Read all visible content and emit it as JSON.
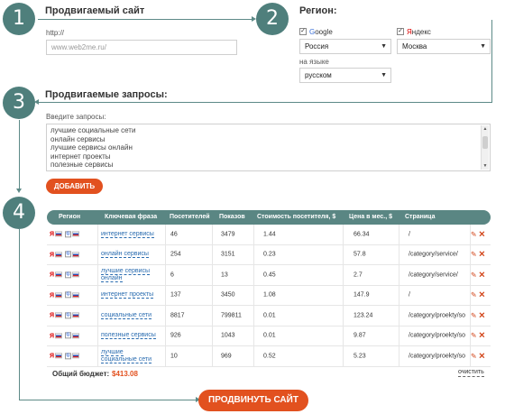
{
  "steps": [
    "1",
    "2",
    "3",
    "4"
  ],
  "site": {
    "title": "Продвигаемый сайт",
    "protocol": "http://",
    "placeholder": "www.web2me.ru/"
  },
  "region": {
    "title": "Регион:",
    "google": {
      "label_g": "G",
      "label_rest": "oogle",
      "checked": true,
      "value": "Россия"
    },
    "yandex": {
      "label_y": "Я",
      "label_rest": "ндекс",
      "checked": true,
      "value": "Москва"
    },
    "lang_label": "на языке",
    "lang_value": "русском"
  },
  "queries": {
    "title": "Продвигаемые запросы:",
    "label": "Введите запросы:",
    "lines": [
      "лучшие социальные сети",
      "онлайн сервисы",
      "лучшие сервисы онлайн",
      "интернет проекты",
      "полезные сервисы"
    ],
    "add_button": "ДОБАВИТЬ"
  },
  "table": {
    "headers": [
      "Регион",
      "Ключевая фраза",
      "Посетителей",
      "Показов",
      "Стоимость посетителя, $",
      "Цена в мес., $",
      "Страница"
    ],
    "rows": [
      {
        "phrase": "интернет сервисы",
        "visitors": "46",
        "shows": "3479",
        "cost": "1.44",
        "price": "66.34",
        "page": "/"
      },
      {
        "phrase": "онлайн сервисы",
        "visitors": "254",
        "shows": "3151",
        "cost": "0.23",
        "price": "57.8",
        "page": "/category/service/"
      },
      {
        "phrase": "лучшие сервисы онлайн",
        "visitors": "6",
        "shows": "13",
        "cost": "0.45",
        "price": "2.7",
        "page": "/category/service/"
      },
      {
        "phrase": "интернет проекты",
        "visitors": "137",
        "shows": "3450",
        "cost": "1.08",
        "price": "147.9",
        "page": "/"
      },
      {
        "phrase": "социальные сети",
        "visitors": "8817",
        "shows": "799811",
        "cost": "0.01",
        "price": "123.24",
        "page": "/category/proekty/so"
      },
      {
        "phrase": "полезные сервисы",
        "visitors": "926",
        "shows": "1043",
        "cost": "0.01",
        "price": "9.87",
        "page": "/category/proekty/so"
      },
      {
        "phrase": "лучшие социальные сети",
        "visitors": "10",
        "shows": "969",
        "cost": "0.52",
        "price": "5.23",
        "page": "/category/proekty/so"
      }
    ],
    "budget_label": "Общий бюджет:",
    "budget_value": "$413.08",
    "clear_link": "очистить"
  },
  "submit_button": "ПРОДВИНУТЬ САЙТ",
  "colors": {
    "accent": "#e2511f",
    "step": "#4f7f7c",
    "header": "#5a8683",
    "link": "#2a6cb0"
  },
  "icons": {
    "edit": "pencil-icon",
    "delete": "cross-icon",
    "check": "checkmark-icon"
  }
}
